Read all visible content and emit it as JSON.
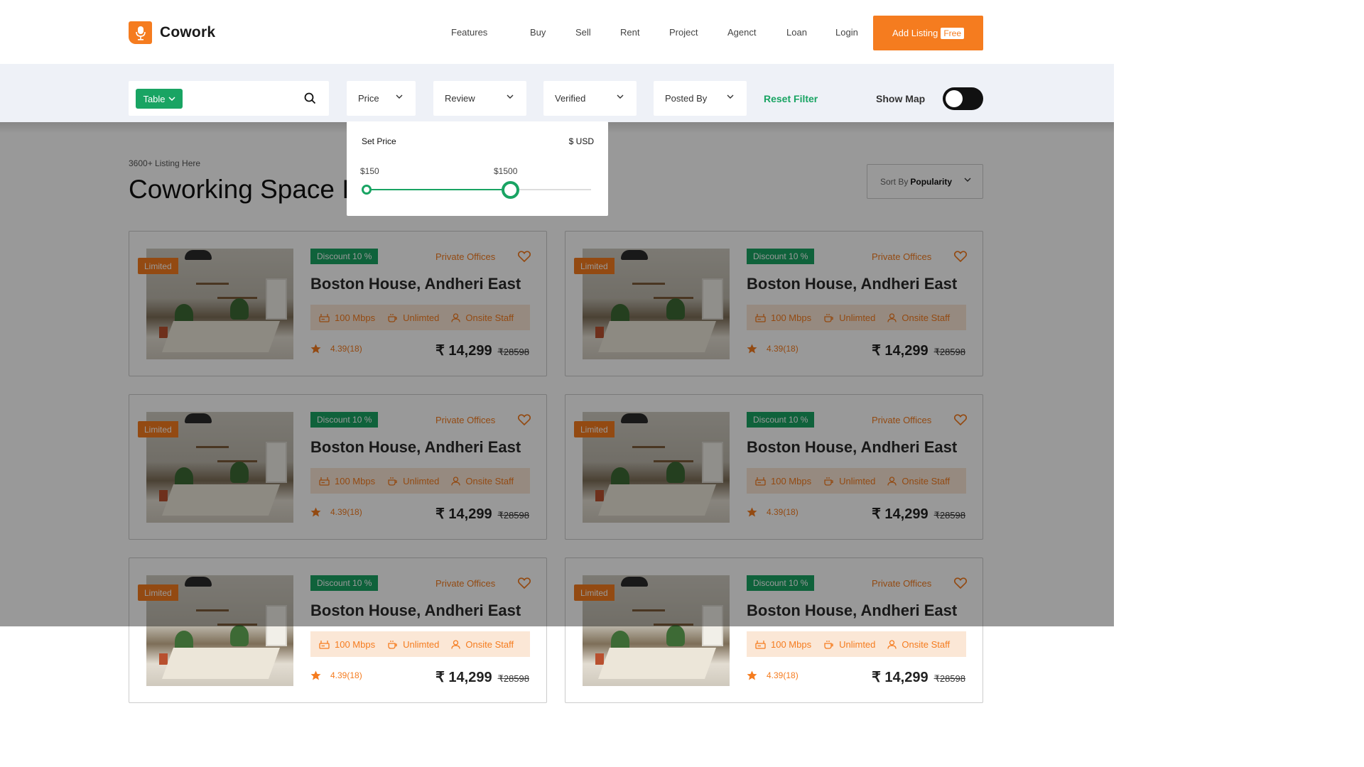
{
  "header": {
    "brand": "Cowork",
    "nav": [
      "Features",
      "Buy",
      "Sell",
      "Rent",
      "Project",
      "Agenct",
      "Loan",
      "Login"
    ],
    "add_listing_label": "Add Listing",
    "free_badge": "Free",
    "accent_color": "#f57c1f"
  },
  "filters": {
    "table_label": "Table",
    "price_label": "Price",
    "review_label": "Review",
    "verified_label": "Verified",
    "posted_by_label": "Posted By",
    "reset_label": "Reset Filter",
    "show_map_label": "Show Map",
    "show_map_on": false,
    "accent_color": "#19a463"
  },
  "price_popup": {
    "title": "Set Price",
    "currency": "$ USD",
    "min_label": "$150",
    "max_label": "$1500",
    "max_fraction": 0.64
  },
  "listing_header": {
    "count_text": "3600+ Listing Here",
    "title": "Coworking Space In",
    "sort_prefix": "Sort By",
    "sort_value": "Popularity"
  },
  "listings": [
    {
      "badge": "Limited",
      "discount": "Discount 10 %",
      "category": "Private Offices",
      "title": "Boston House, Andheri East",
      "amenities": [
        "100 Mbps",
        "Unlimted",
        "Onsite Staff"
      ],
      "rating": "4.39(18)",
      "price": "₹ 14,299",
      "old_price": "₹28598"
    },
    {
      "badge": "Limited",
      "discount": "Discount 10 %",
      "category": "Private Offices",
      "title": "Boston House, Andheri East",
      "amenities": [
        "100 Mbps",
        "Unlimted",
        "Onsite Staff"
      ],
      "rating": "4.39(18)",
      "price": "₹ 14,299",
      "old_price": "₹28598"
    },
    {
      "badge": "Limited",
      "discount": "Discount 10 %",
      "category": "Private Offices",
      "title": "Boston House, Andheri East",
      "amenities": [
        "100 Mbps",
        "Unlimted",
        "Onsite Staff"
      ],
      "rating": "4.39(18)",
      "price": "₹ 14,299",
      "old_price": "₹28598"
    },
    {
      "badge": "Limited",
      "discount": "Discount 10 %",
      "category": "Private Offices",
      "title": "Boston House, Andheri East",
      "amenities": [
        "100 Mbps",
        "Unlimted",
        "Onsite Staff"
      ],
      "rating": "4.39(18)",
      "price": "₹ 14,299",
      "old_price": "₹28598"
    },
    {
      "badge": "Limited",
      "discount": "Discount 10 %",
      "category": "Private Offices",
      "title": "Boston House, Andheri East",
      "amenities": [
        "100 Mbps",
        "Unlimted",
        "Onsite Staff"
      ],
      "rating": "4.39(18)",
      "price": "₹ 14,299",
      "old_price": "₹28598"
    },
    {
      "badge": "Limited",
      "discount": "Discount 10 %",
      "category": "Private Offices",
      "title": "Boston House, Andheri East",
      "amenities": [
        "100 Mbps",
        "Unlimted",
        "Onsite Staff"
      ],
      "rating": "4.39(18)",
      "price": "₹ 14,299",
      "old_price": "₹28598"
    }
  ]
}
